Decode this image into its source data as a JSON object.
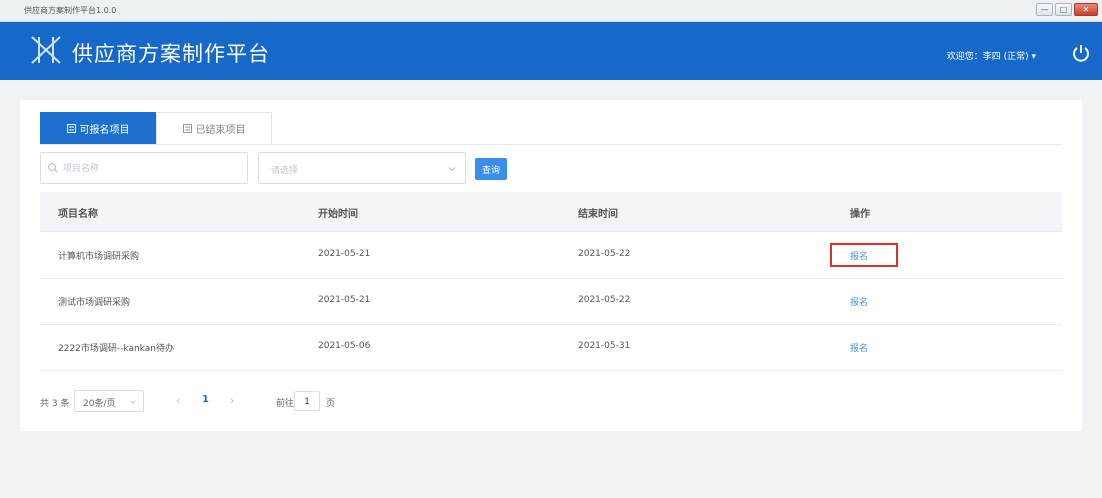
{
  "window": {
    "title": "供应商方案制作平台1.0.0",
    "minimize": "—",
    "maximize": "□",
    "close": "✕"
  },
  "header": {
    "app_title": "供应商方案制作平台",
    "user": "欢迎您：李四 (正常) ▾",
    "logo_icon": "lattice-logo-icon",
    "power_icon": "power-icon"
  },
  "tabs": [
    {
      "label": "可报名项目",
      "active": true
    },
    {
      "label": "已结束项目",
      "active": false
    }
  ],
  "filters": {
    "search_placeholder": "项目名称",
    "select_placeholder": "请选择",
    "search_button": "查询"
  },
  "table": {
    "columns": [
      "项目名称",
      "开始时间",
      "结束时间",
      "操作"
    ],
    "rows": [
      {
        "name": "计算机市场调研采购",
        "start": "2021-05-21",
        "end": "2021-05-22",
        "action": "报名"
      },
      {
        "name": "测试市场调研采购",
        "start": "2021-05-21",
        "end": "2021-05-22",
        "action": "报名"
      },
      {
        "name": "2222市场调研--kankan待办",
        "start": "2021-05-06",
        "end": "2021-05-31",
        "action": "报名"
      }
    ]
  },
  "pagination": {
    "total": "共 3 条",
    "page_size": "20条/页",
    "prev": "‹",
    "current": "1",
    "next": "›",
    "goto_label": "前往",
    "goto_value": "1",
    "page_label": "页"
  },
  "colors": {
    "primary": "#1669c9",
    "tab_active": "#1d70cf",
    "link": "#4a90e2",
    "highlight": "#d9322c"
  }
}
